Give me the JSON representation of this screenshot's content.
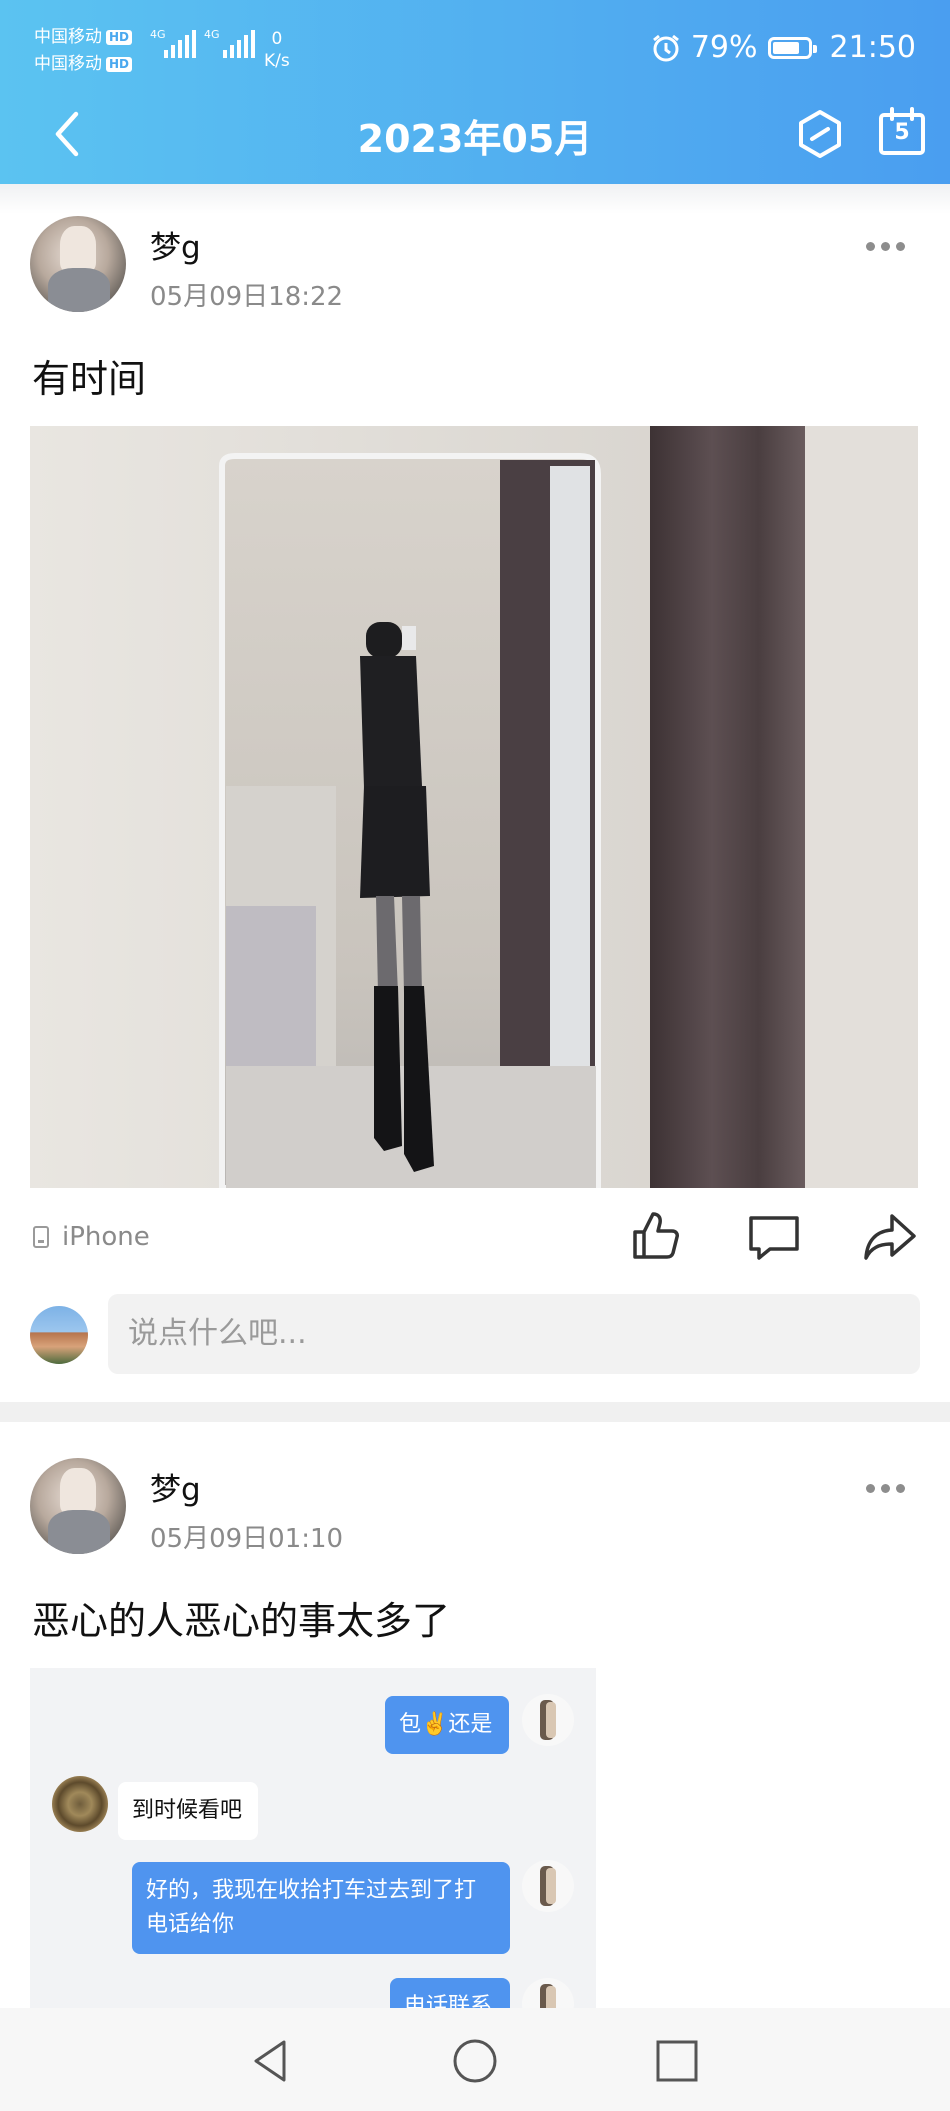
{
  "status_bar": {
    "carrier1": "中国移动",
    "carrier2": "中国移动",
    "hd": "HD",
    "net": "4G",
    "speed_value": "0",
    "speed_unit": "K/s",
    "battery": "79%",
    "battery_level": 0.79,
    "time": "21:50"
  },
  "nav": {
    "title": "2023年05月",
    "back_icon": "chevron-left-icon",
    "hex_icon": "hexagon-slash-icon",
    "calendar_icon": "calendar-icon",
    "calendar_day": "5"
  },
  "posts": [
    {
      "user": "梦g",
      "time": "05月09日18:22",
      "text": "有时间",
      "device": "iPhone",
      "comment_placeholder": "说点什么吧..."
    },
    {
      "user": "梦g",
      "time": "05月09日01:10",
      "text": "恶心的人恶心的事太多了",
      "chat": [
        {
          "side": "me",
          "text": "包✌️还是"
        },
        {
          "side": "them",
          "text": "到时候看吧"
        },
        {
          "side": "me",
          "text": "好的，我现在收拾打车过去到了打电话给你"
        },
        {
          "side": "me",
          "text": "电话联系"
        }
      ]
    }
  ],
  "actions": {
    "like_icon": "thumbs-up-icon",
    "comment_icon": "comment-icon",
    "share_icon": "share-icon"
  },
  "system_nav": {
    "back": "triangle-back-icon",
    "home": "circle-home-icon",
    "recents": "square-recents-icon"
  },
  "colors": {
    "header_start": "#5bc3f1",
    "header_end": "#4a9ef0",
    "bubble_me": "#4f94ef"
  }
}
